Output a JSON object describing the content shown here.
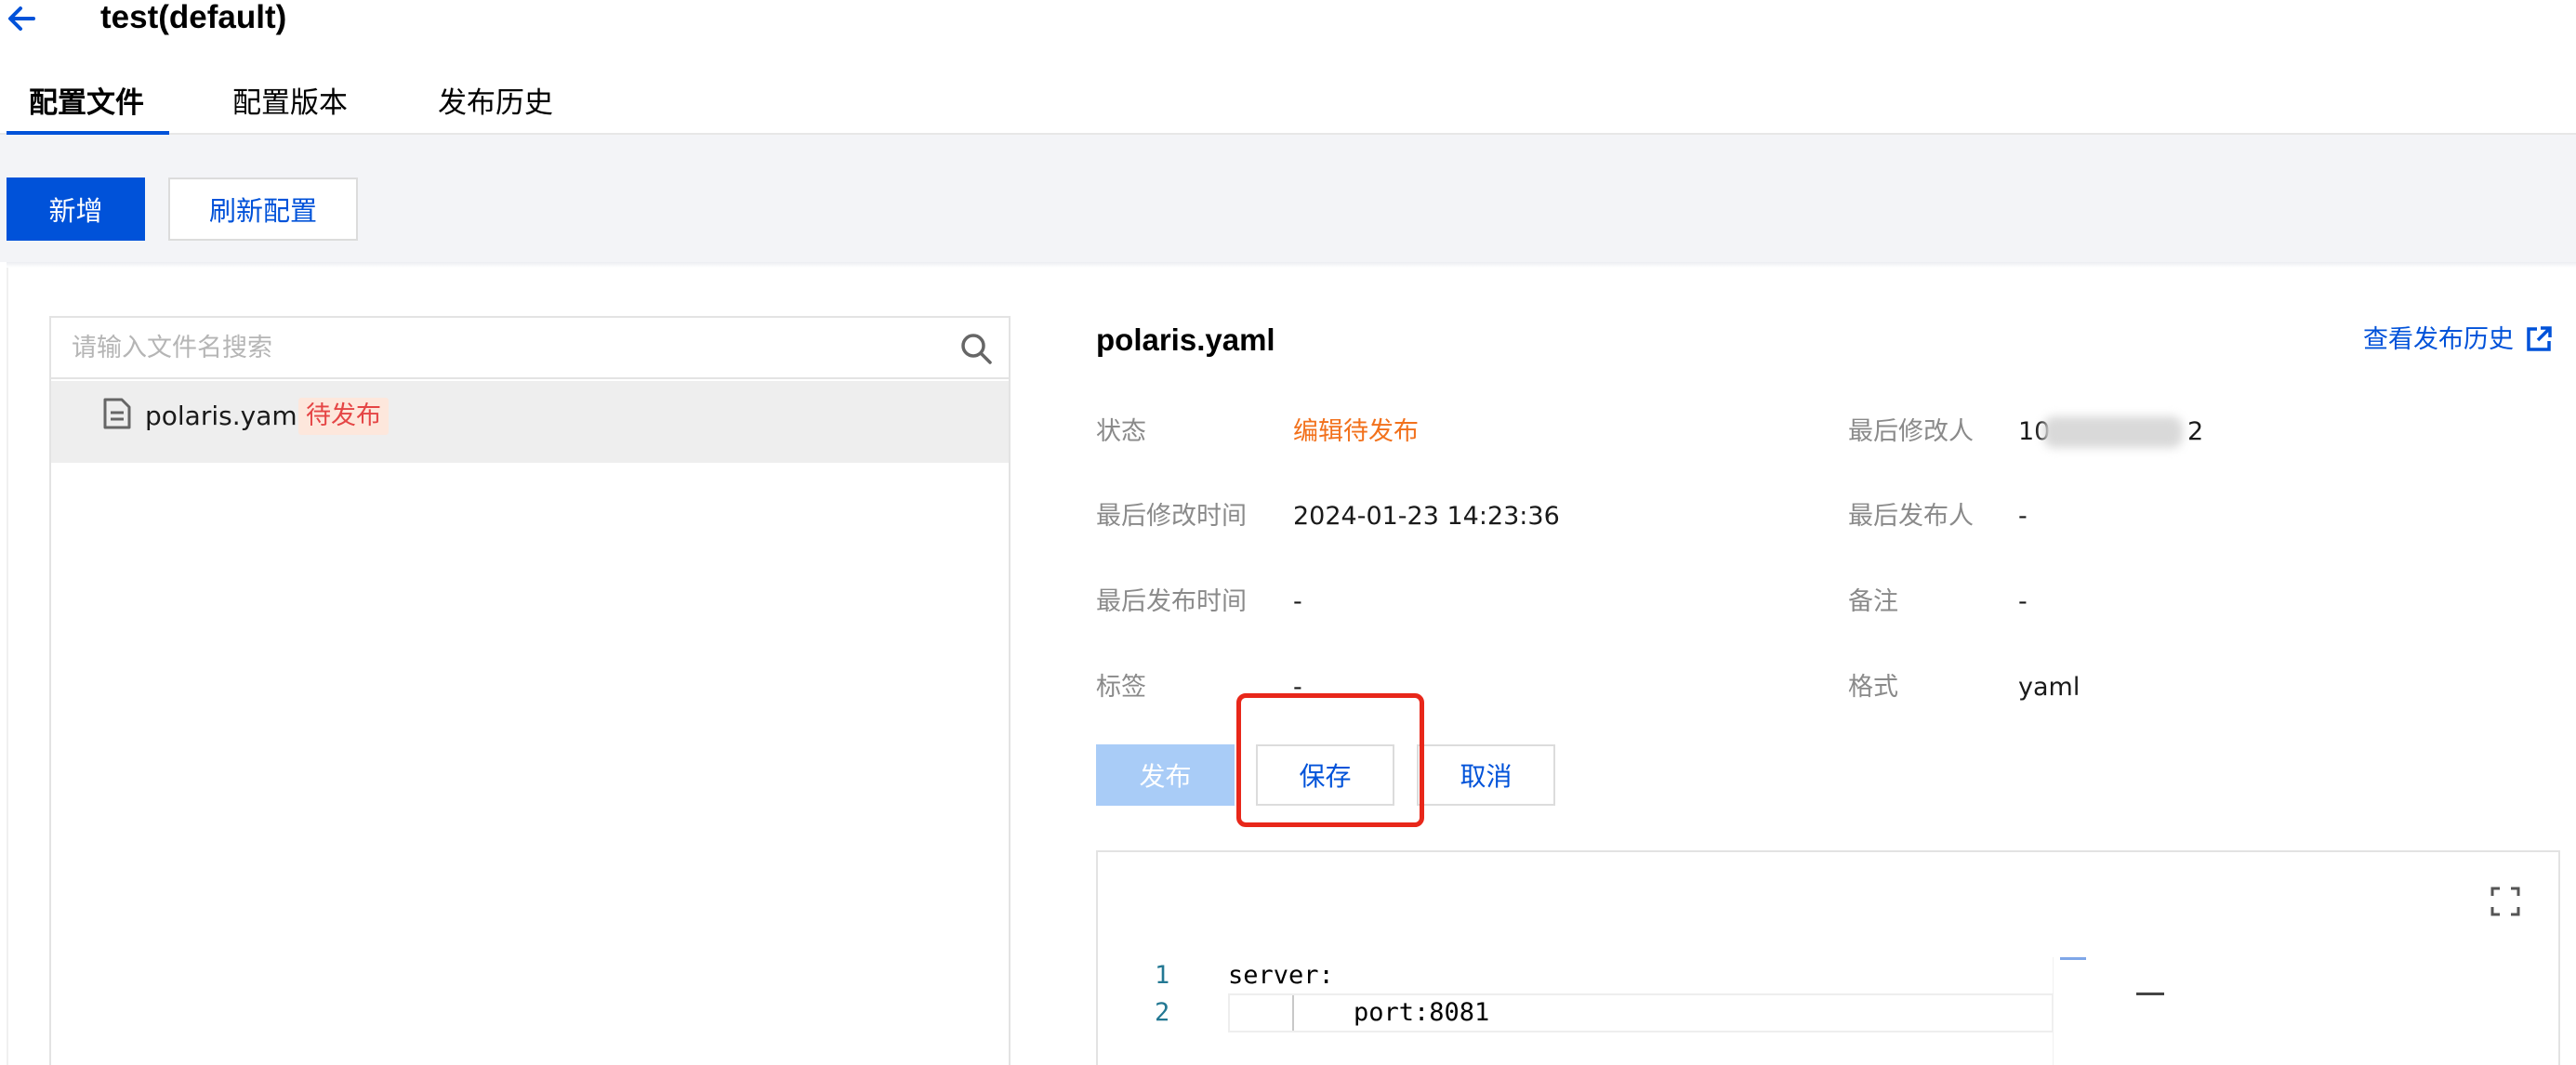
{
  "header": {
    "title": "test(default)",
    "back_icon": "arrow-left-icon"
  },
  "tabs": [
    {
      "label": "配置文件",
      "active": true
    },
    {
      "label": "配置版本",
      "active": false
    },
    {
      "label": "发布历史",
      "active": false
    }
  ],
  "toolbar": {
    "new_label": "新增",
    "refresh_label": "刷新配置"
  },
  "file_list": {
    "search_placeholder": "请输入文件名搜索",
    "search_value": "",
    "items": [
      {
        "name": "polaris.yaml",
        "badge": "待发布",
        "icon": "file-icon"
      }
    ]
  },
  "detail": {
    "title": "polaris.yaml",
    "view_history_label": "查看发布历史",
    "fields": {
      "status": {
        "label": "状态",
        "value": "编辑待发布"
      },
      "last_modifier": {
        "label": "最后修改人",
        "value_start": "10",
        "value_end": "2"
      },
      "last_modified_time": {
        "label": "最后修改时间",
        "value": "2024-01-23 14:23:36"
      },
      "last_publisher": {
        "label": "最后发布人",
        "value": "-"
      },
      "last_publish_time": {
        "label": "最后发布时间",
        "value": "-"
      },
      "remark": {
        "label": "备注",
        "value": "-"
      },
      "tags": {
        "label": "标签",
        "value": "-"
      },
      "format": {
        "label": "格式",
        "value": "yaml"
      }
    },
    "buttons": {
      "publish_label": "发布",
      "save_label": "保存",
      "cancel_label": "取消"
    }
  },
  "editor": {
    "lines": [
      {
        "number": "1",
        "text": "server:"
      },
      {
        "number": "2",
        "text": "port:8081"
      }
    ]
  },
  "colors": {
    "primary": "#0052d9",
    "status_orange": "#f2711c",
    "badge_text": "#e54545",
    "badge_bg": "#fde7dc",
    "highlight_red": "#e8271a",
    "disabled_primary": "#a9ccf7"
  }
}
